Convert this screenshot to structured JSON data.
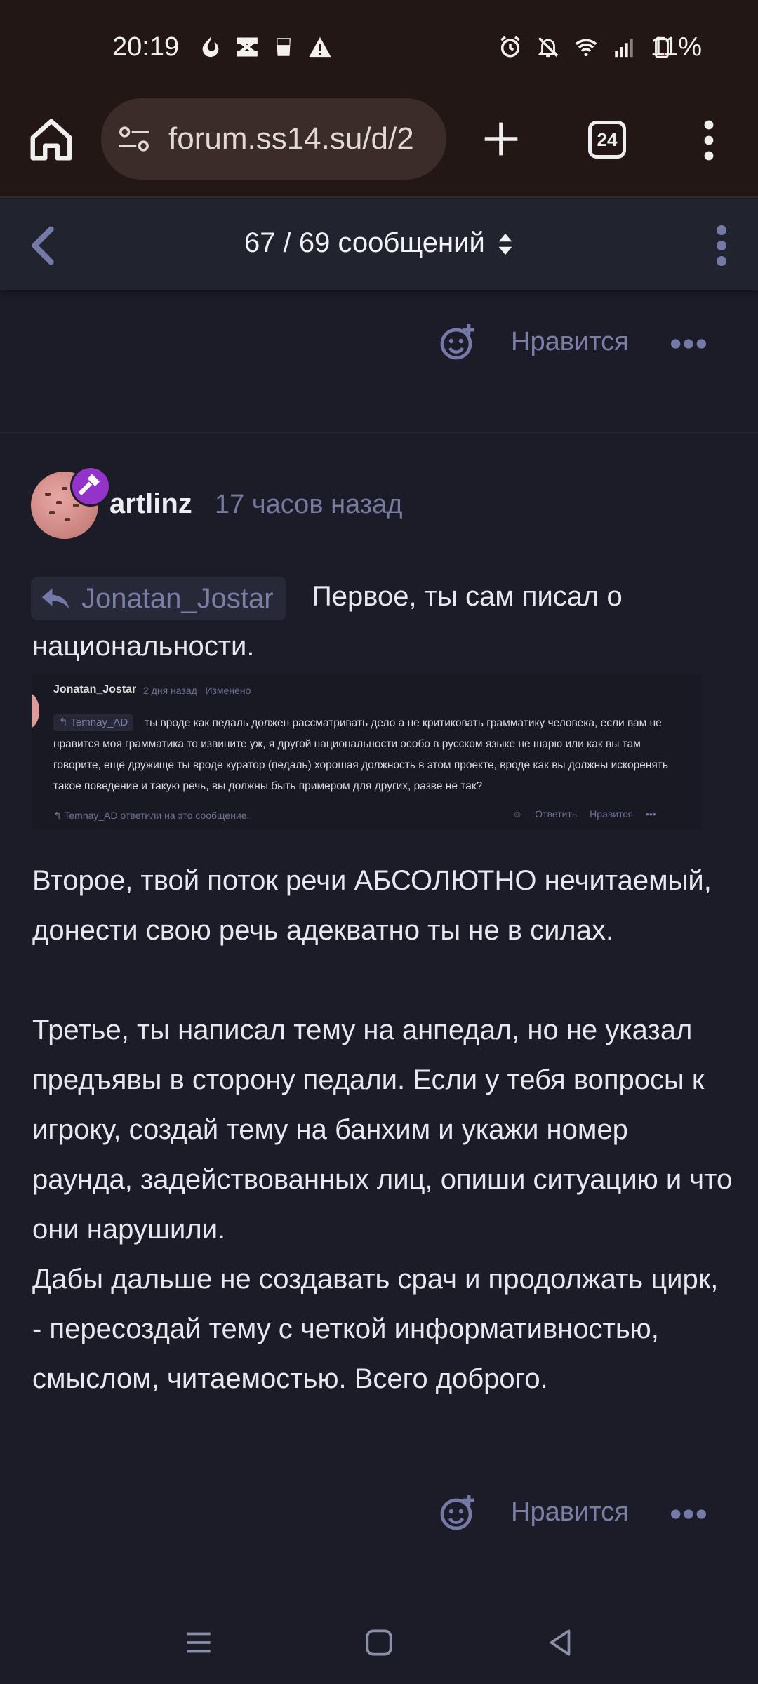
{
  "status": {
    "time": "20:19",
    "battery": "11%"
  },
  "browser": {
    "url": "forum.ss14.su/d/2",
    "tab_count": "24"
  },
  "toolbar": {
    "counter": "67 / 69 сообщений"
  },
  "prev_post": {
    "like_label": "Нравится"
  },
  "post": {
    "author": "artlinz",
    "time": "17 часов назад",
    "reply_to": "Jonatan_Jostar",
    "intro": "Первое, ты сам писал о национальности.",
    "paragraphs": [
      "Второе, твой поток речи АБСОЛЮТНО нечитаемый, донести свою речь адекватно ты не в силах.",
      "Третье, ты написал тему на анпедал, но не указал предъявы в сторону педали. Если у тебя вопросы к игроку, создай тему на банхим и укажи номер раунда, задействованных лиц, опиши ситуацию и что они нарушили.",
      "Дабы дальше не создавать срач и продолжать цирк, - пересоздай тему с четкой информативностью, смыслом, читаемостью. Всего доброго."
    ],
    "like_label": "Нравится"
  },
  "quote_image": {
    "author": "Jonatan_Jostar",
    "time": "2 дня назад",
    "edited": "Изменено",
    "reply_chip": "Temnay_AD",
    "text": "ты вроде как педаль должен рассматривать дело а не критиковать грамматику человека, если вам не нравится моя грамматика то извините уж, я другой национальности особо в русском языке не шарю или как вы там говорите, ещё дружище ты вроде куратор (педаль) хорошая должность в этом проекте, вроде как вы должны искоренять такое поведение и такую речь, вы должны быть примером для других, разве не так?",
    "replied": "Temnay_AD ответили на это сообщение.",
    "reply_btn": "Ответить",
    "like_btn": "Нравится"
  },
  "colors": {
    "background": "#1b1c27",
    "muted_text": "#7c7fa5",
    "badge": "#9333c9"
  }
}
